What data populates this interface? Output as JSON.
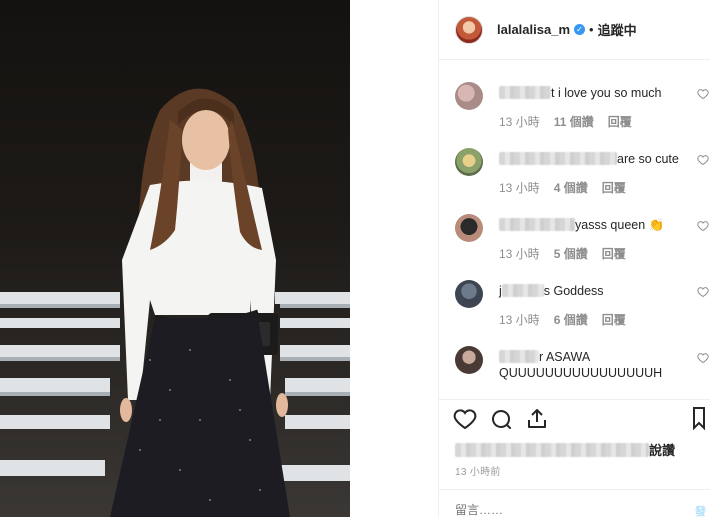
{
  "post_author": {
    "username": "lalalalisa_m",
    "verified_icon": "verified-badge-icon",
    "separator": "•",
    "follow_label": "追蹤中"
  },
  "comments": [
    {
      "text": "t i love you so much",
      "time": "13 小時",
      "likes": "11 個讚",
      "reply": "回覆"
    },
    {
      "text": "are so cute",
      "time": "13 小時",
      "likes": "4 個讚",
      "reply": "回覆"
    },
    {
      "text": "yasss queen 👏",
      "time": "13 小時",
      "likes": "5 個讚",
      "reply": "回覆"
    },
    {
      "text_prefix": "j",
      "text": "s Goddess",
      "time": "13 小時",
      "likes": "6 個讚",
      "reply": "回覆"
    },
    {
      "text": "r ASAWA",
      "text_line2": "QUUUUUUUUUUUUUUUUH"
    }
  ],
  "likes_suffix": "說讚",
  "timestamp": "13 小時前",
  "comment_placeholder": "留言……",
  "post_label": "發",
  "colors": {
    "link_blue": "#3897f0",
    "muted": "#8e8e8e",
    "border": "#efefef"
  }
}
